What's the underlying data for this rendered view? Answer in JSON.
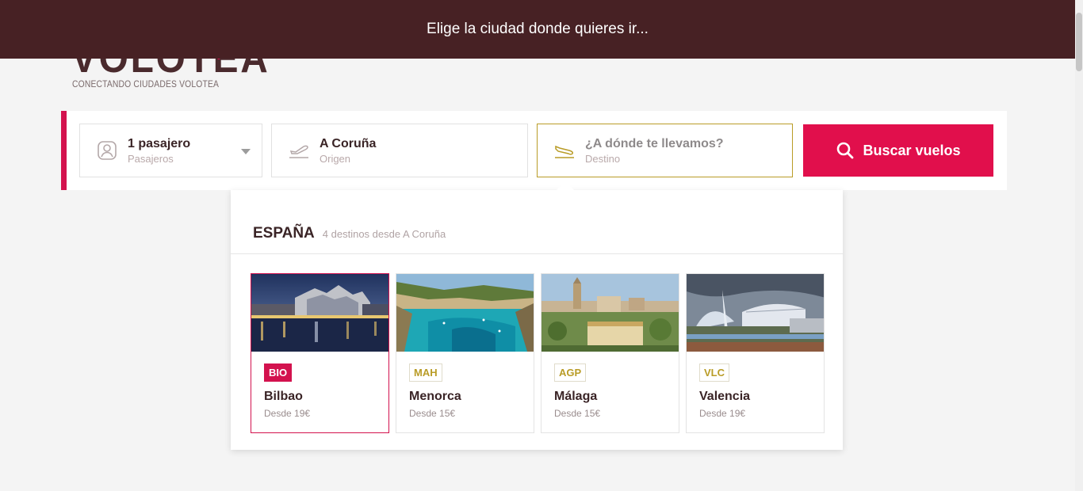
{
  "banner": {
    "text": "Elige la ciudad donde quieres ir..."
  },
  "logo": {
    "word": "VOLOTEA",
    "tagline": "CONECTANDO CIUDADES VOLOTEA"
  },
  "search": {
    "passengers": {
      "value": "1 pasajero",
      "label": "Pasajeros",
      "icon": "passenger-icon"
    },
    "origin": {
      "value": "A Coruña",
      "label": "Origen",
      "icon": "takeoff-icon"
    },
    "destination": {
      "placeholder": "¿A dónde te llevamos?",
      "label": "Destino",
      "icon": "landing-icon"
    },
    "button": {
      "label": "Buscar vuelos",
      "icon": "search-icon"
    }
  },
  "dropdown": {
    "country": "ESPAÑA",
    "count_text": "4 destinos desde A Coruña",
    "destinations": [
      {
        "code": "BIO",
        "city": "Bilbao",
        "price": "Desde 19€"
      },
      {
        "code": "MAH",
        "city": "Menorca",
        "price": "Desde 15€"
      },
      {
        "code": "AGP",
        "city": "Málaga",
        "price": "Desde 15€"
      },
      {
        "code": "VLC",
        "city": "Valencia",
        "price": "Desde 19€"
      }
    ]
  },
  "colors": {
    "brand": "#d3124e",
    "banner": "#472124",
    "accent": "#b99c27",
    "button": "#e10f4c"
  }
}
